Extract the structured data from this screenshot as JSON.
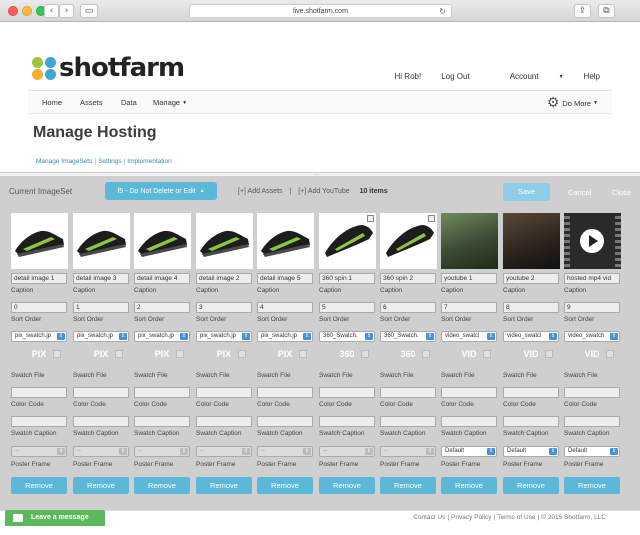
{
  "browser": {
    "url": "live.shotfarm.com",
    "back_glyph": "‹",
    "forward_glyph": "›",
    "sidebar_glyph": "▭",
    "reload_glyph": "↻",
    "share_glyph": "⇪",
    "tabs_glyph": "⧉"
  },
  "brand": {
    "name": "shotfarm",
    "dot_colors": [
      "#9bc53d",
      "#3fa7d6",
      "#f6ae2d",
      "#3fa7d6"
    ]
  },
  "topnav": {
    "greeting": "Hi Rob!",
    "logout": "Log Out",
    "account": "Account",
    "help": "Help"
  },
  "mainnav": {
    "home": "Home",
    "assets": "Assets",
    "data": "Data",
    "manage": "Manage",
    "do_more": "Do More"
  },
  "page": {
    "title": "Manage Hosting",
    "subnav": [
      "Manage ImageSets",
      "Settings",
      "Implementation"
    ]
  },
  "panel": {
    "current_label": "Current ImageSet",
    "selected_set": "f5 - Do Not Delete or Edit",
    "add_assets": "[+] Add Assets",
    "add_youtube": "[+] Add YouTube",
    "count": "10 items",
    "save": "Save",
    "cancel": "Cancel",
    "close": "Close"
  },
  "labels": {
    "caption": "Caption",
    "sort_order": "Sort Order",
    "swatch_file": "Swatch File",
    "color_code": "Color Code",
    "swatch_caption": "Swatch Caption",
    "poster_frame": "Poster Frame",
    "remove": "Remove"
  },
  "items": [
    {
      "caption": "detail image 1",
      "sort": "0",
      "swatch": "pix_swatch.jp",
      "badge": "PIX",
      "poster": "--",
      "kind": "shoe"
    },
    {
      "caption": "detail image 3",
      "sort": "1",
      "swatch": "pix_swatch.jp",
      "badge": "PIX",
      "poster": "--",
      "kind": "shoe"
    },
    {
      "caption": "detail image 4",
      "sort": "2",
      "swatch": "pix_swatch.jp",
      "badge": "PIX",
      "poster": "--",
      "kind": "shoe"
    },
    {
      "caption": "detail image 2",
      "sort": "3",
      "swatch": "pix_swatch.jp",
      "badge": "PIX",
      "poster": "--",
      "kind": "shoe"
    },
    {
      "caption": "detail image 5",
      "sort": "4",
      "swatch": "pix_swatch.jp",
      "badge": "PIX",
      "poster": "--",
      "kind": "shoe"
    },
    {
      "caption": "360 spin 1",
      "sort": "5",
      "swatch": "360_Swatch.",
      "badge": "360",
      "poster": "--",
      "kind": "spin"
    },
    {
      "caption": "360 spin 2",
      "sort": "6",
      "swatch": "360_Swatch.",
      "badge": "360",
      "poster": "--",
      "kind": "spin"
    },
    {
      "caption": "youtube 1",
      "sort": "7",
      "swatch": "video_swatcl",
      "badge": "VID",
      "poster": "Default",
      "kind": "video"
    },
    {
      "caption": "youtube 2",
      "sort": "8",
      "swatch": "video_swatcl",
      "badge": "VID",
      "poster": "Default",
      "kind": "video2"
    },
    {
      "caption": "hosted mp4 vid",
      "sort": "9",
      "swatch": "video_swatch",
      "badge": "VID",
      "poster": "Default",
      "kind": "mp4"
    }
  ],
  "footer": {
    "leave_message": "Leave a message",
    "links": [
      "Contact Us",
      "Privacy Policy",
      "Terms of Use",
      "© 2015 Shotfarm, LLC"
    ]
  }
}
